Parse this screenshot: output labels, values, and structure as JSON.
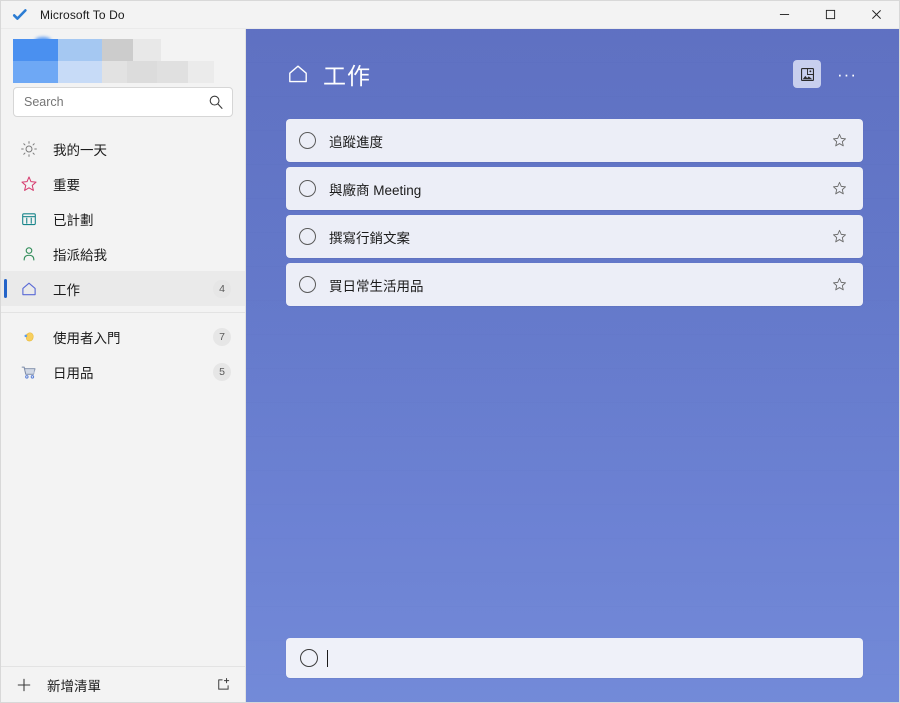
{
  "window": {
    "app_icon": "checkmark-icon",
    "title": "Microsoft To Do",
    "controls": {
      "minimize": "–",
      "maximize": "□",
      "close": "✕"
    }
  },
  "sidebar": {
    "profile": {
      "redacted": true
    },
    "search": {
      "placeholder": "Search",
      "value": "",
      "icon": "search-icon"
    },
    "groups": [
      {
        "items": [
          {
            "icon": "sun-icon",
            "label": "我的一天",
            "count": "",
            "selected": false
          },
          {
            "icon": "star-icon",
            "label": "重要",
            "count": "",
            "selected": false
          },
          {
            "icon": "calendar-icon",
            "label": "已計劃",
            "count": "",
            "selected": false
          },
          {
            "icon": "person-icon",
            "label": "指派給我",
            "count": "",
            "selected": false
          },
          {
            "icon": "home-icon",
            "label": "工作",
            "count": "4",
            "selected": true
          }
        ]
      },
      {
        "items": [
          {
            "icon": "waving-hand-icon",
            "label": "使用者入門",
            "count": "7",
            "selected": false
          },
          {
            "icon": "shopping-cart-icon",
            "label": "日用品",
            "count": "5",
            "selected": false
          }
        ]
      }
    ],
    "footer": {
      "plus_icon": "plus-icon",
      "new_list_label": "新增清單",
      "new_group_icon": "new-group-icon"
    }
  },
  "main": {
    "header": {
      "list_icon": "home-icon",
      "title": "工作",
      "background_button_icon": "change-background-icon",
      "more_button_label": "···"
    },
    "tasks": [
      {
        "title": "追蹤進度",
        "completed": false,
        "starred": false
      },
      {
        "title": "與廠商 Meeting",
        "completed": false,
        "starred": false
      },
      {
        "title": "撰寫行銷文案",
        "completed": false,
        "starred": false
      },
      {
        "title": "買日常生活用品",
        "completed": false,
        "starred": false
      }
    ],
    "add_task": {
      "placeholder": "",
      "value": "",
      "focused": true
    }
  },
  "colors": {
    "accent": "#2464c8",
    "main_background_top": "#5d6fc1",
    "main_background_bottom": "#7189d8",
    "task_card": "#eceef7",
    "sidebar": "#f3f3f3"
  }
}
